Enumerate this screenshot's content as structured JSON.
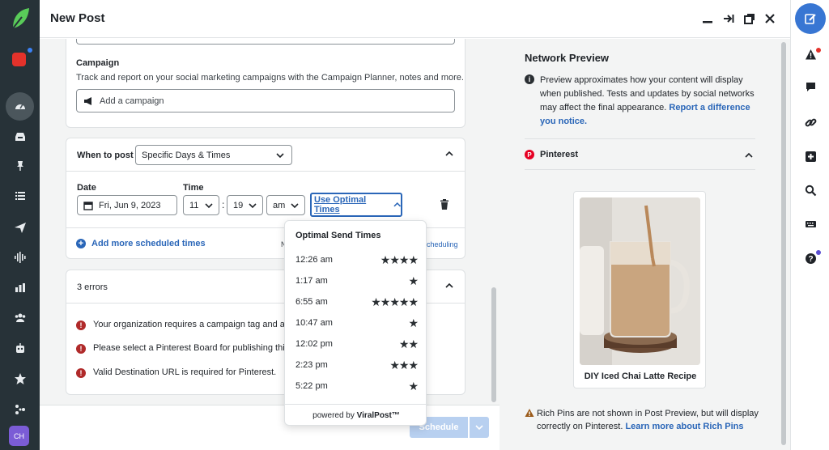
{
  "header": {
    "title": "New Post"
  },
  "campaign": {
    "label": "Campaign",
    "description": "Track and report on your social marketing campaigns with the Campaign Planner, notes and more.",
    "input_placeholder": "Add a campaign"
  },
  "schedule": {
    "when_label": "When to post",
    "when_value": "Specific Days & Times",
    "date_label": "Date",
    "date_value": "Fri, Jun 9, 2023",
    "time_label": "Time",
    "hour_value": "11",
    "separator": ":",
    "minute_value": "19",
    "ampm_value": "am",
    "optimal_link": "Use Optimal Times",
    "add_more": "Add more scheduled times",
    "partial_left": "N",
    "partial_right": "cheduling"
  },
  "errors": {
    "title": "3 errors",
    "items": [
      "Your organization requires a campaign tag and a la",
      "Please select a Pinterest Board for publishing this",
      "Valid Destination URL is required for Pinterest."
    ]
  },
  "footer": {
    "schedule_button": "Schedule"
  },
  "optimal_popover": {
    "title": "Optimal Send Times",
    "options": [
      {
        "time": "12:26 am",
        "stars": 4
      },
      {
        "time": "1:17 am",
        "stars": 1
      },
      {
        "time": "6:55 am",
        "stars": 5
      },
      {
        "time": "10:47 am",
        "stars": 1
      },
      {
        "time": "12:02 pm",
        "stars": 2
      },
      {
        "time": "2:23 pm",
        "stars": 3
      },
      {
        "time": "5:22 pm",
        "stars": 1
      }
    ],
    "footer_prefix": "powered by ",
    "footer_brand": "ViralPost™"
  },
  "preview": {
    "title": "Network Preview",
    "note": "Preview approximates how your content will display when published. Tests and updates by social networks may affect the final appearance. ",
    "note_link": "Report a difference you notice.",
    "network": "Pinterest",
    "pin_caption": "DIY Iced Chai Latte Recipe",
    "rich_note": "Rich Pins are not shown in Post Preview, but will display correctly on Pinterest. ",
    "rich_link": "Learn more about Rich Pins"
  },
  "user": {
    "initials": "CH"
  },
  "colors": {
    "nav_bg": "#273238",
    "accent": "#3876d3",
    "link": "#2a66b8",
    "error": "#b02a2a",
    "pinterest": "#e60023"
  }
}
